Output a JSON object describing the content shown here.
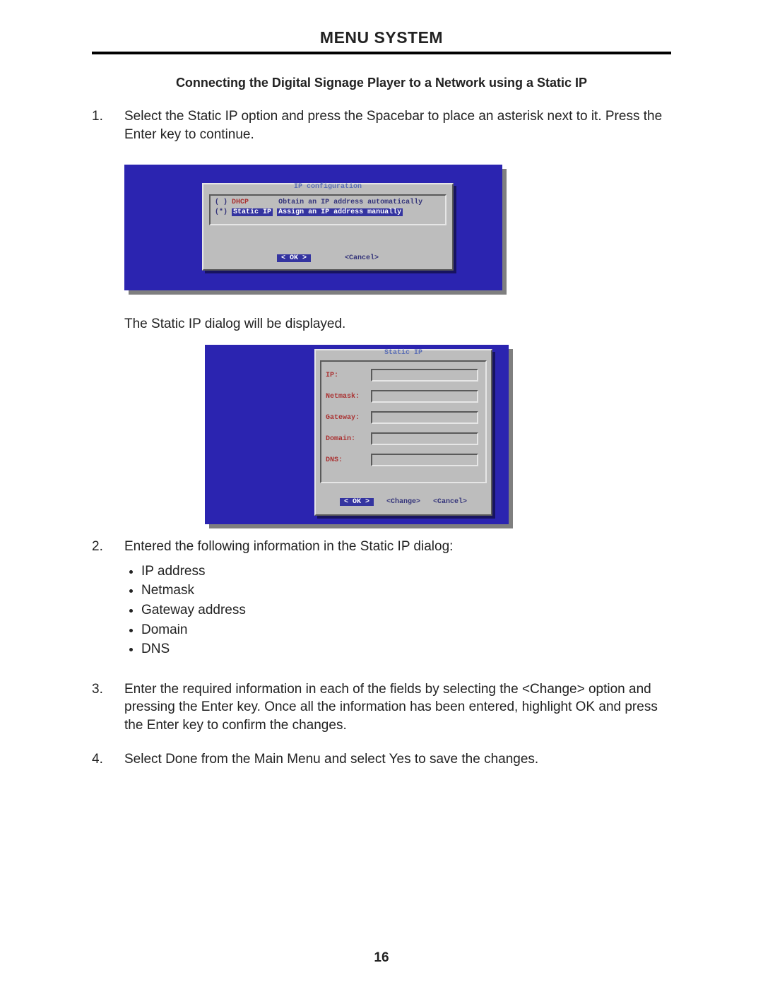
{
  "header": "MENU SYSTEM",
  "subheader": "Connecting the Digital Signage Player to a Network using a Static IP",
  "steps": {
    "s1": {
      "num": "1.",
      "text": "Select the Static IP option and press the Spacebar to place an asterisk next to it.  Press the Enter key to continue."
    },
    "s2": {
      "num": "2.",
      "text": "Entered the following information in the Static IP dialog:"
    },
    "s3": {
      "num": "3.",
      "text": "Enter the required information in each of the fields by selecting the <Change> option and pressing the Enter key.  Once all the information has been entered, highlight OK and press the Enter key to confirm the changes."
    },
    "s4": {
      "num": "4.",
      "text": "Select Done from the Main Menu and select Yes to save the changes."
    }
  },
  "caption": "The Static IP dialog will be displayed.",
  "bullets": {
    "b1": "IP address",
    "b2": "Netmask",
    "b3": "Gateway address",
    "b4": "Domain",
    "b5": "DNS"
  },
  "dialog1": {
    "title": "IP configuration",
    "rows": {
      "r1": {
        "marker": "( )",
        "opt": "DHCP",
        "desc": "Obtain an IP address automatically"
      },
      "r2": {
        "marker": "(*)",
        "opt": "Static IP",
        "desc": "Assign an IP address manually"
      }
    },
    "buttons": {
      "ok": "<  OK  >",
      "cancel": "<Cancel>"
    }
  },
  "dialog2": {
    "title": "Static IP",
    "labels": {
      "ip": "IP:",
      "netmask": "Netmask:",
      "gateway": "Gateway:",
      "domain": "Domain:",
      "dns": "DNS:"
    },
    "buttons": {
      "ok": "<  OK  >",
      "change": "<Change>",
      "cancel": "<Cancel>"
    }
  },
  "page_number": "16"
}
